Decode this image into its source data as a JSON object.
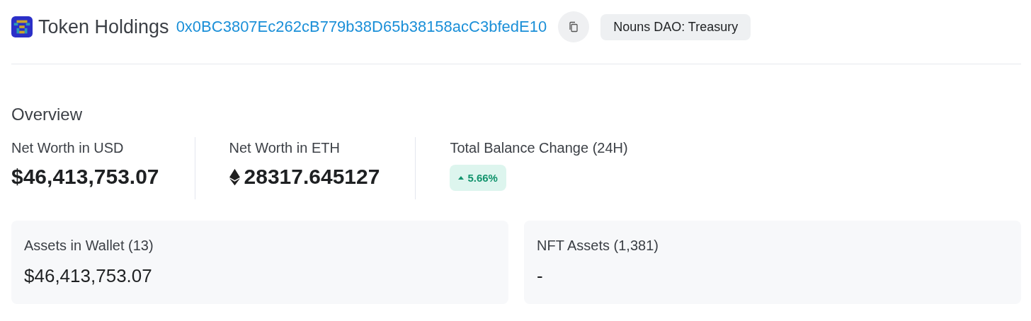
{
  "header": {
    "title": "Token Holdings",
    "address": "0x0BC3807Ec262cB779b38D65b38158acC3bfedE10",
    "tag": "Nouns DAO: Treasury"
  },
  "overview": {
    "title": "Overview",
    "stats": [
      {
        "kind": "usd",
        "label": "Net Worth in USD",
        "value": "$46,413,753.07"
      },
      {
        "kind": "eth",
        "label": "Net Worth in ETH",
        "value": "28317.645127"
      },
      {
        "kind": "change",
        "label": "Total Balance Change (24H)",
        "value": "5.66%",
        "up": true
      }
    ]
  },
  "cards": [
    {
      "label": "Assets in Wallet (13)",
      "value": "$46,413,753.07"
    },
    {
      "label": "NFT Assets (1,381)",
      "value": "-"
    }
  ]
}
